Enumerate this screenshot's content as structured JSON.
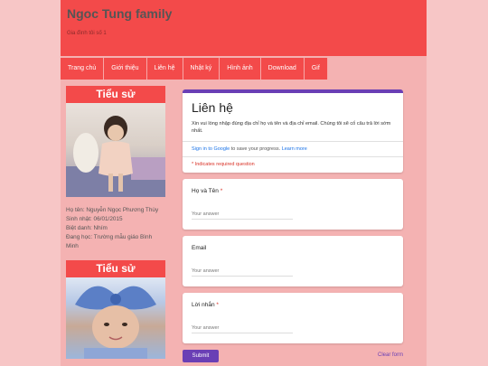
{
  "header": {
    "title": "Ngoc Tung family",
    "description": "Gia đình tôi số 1"
  },
  "nav": {
    "items": [
      "Trang chủ",
      "Giới thiệu",
      "Liên hệ",
      "Nhật ký",
      "Hình ảnh",
      "Download",
      "Gif"
    ]
  },
  "sidebar": {
    "widget1": {
      "title": "Tiểu sử",
      "profile": [
        "Họ tên: Nguyễn Ngọc Phương Thùy",
        "Sinh nhật: 06/01/2015",
        "Biệt danh: Nhím",
        "Đang học: Trường mẫu giáo Bình Minh"
      ]
    },
    "widget2": {
      "title": "Tiểu sử"
    }
  },
  "form": {
    "title": "Liên hệ",
    "description": "Xin vui lòng nhập đúng địa chỉ  họ và tên và địa chỉ email. Chúng tôi sẽ cố câu trả lời sớm nhất.",
    "signin_link": "Sign in to Google",
    "signin_rest": " to save your progress.",
    "learn_more": "Learn more",
    "required_note": "* Indicates required question",
    "questions": [
      {
        "label": "Họ và Tên",
        "required": "*",
        "placeholder": "Your answer"
      },
      {
        "label": "Email",
        "required": "",
        "placeholder": "Your answer"
      },
      {
        "label": "Lời nhắn",
        "required": "*",
        "placeholder": "Your answer"
      }
    ],
    "submit_label": "Submit",
    "clear_label": "Clear form"
  },
  "colors": {
    "header_bg": "#f34a4a",
    "page_bg": "#f4b2b2",
    "form_accent": "#6a3fb5"
  }
}
